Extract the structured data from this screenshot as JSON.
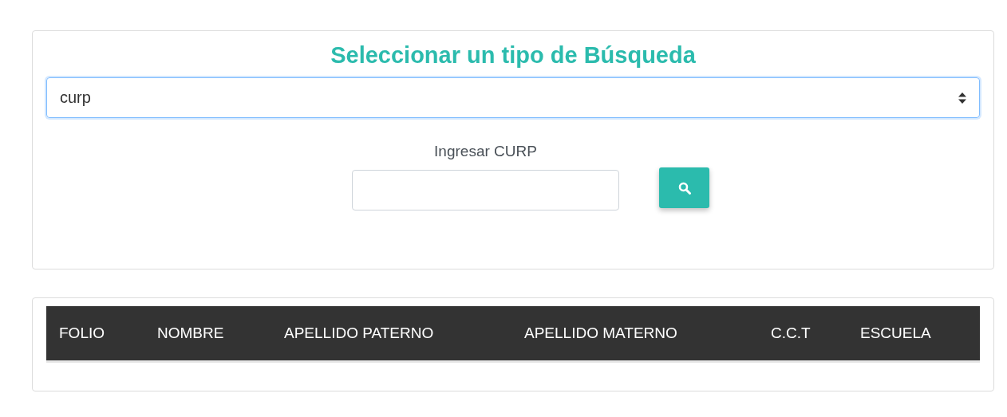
{
  "search_card": {
    "title": "Seleccionar un tipo de Búsqueda",
    "search_type": {
      "value": "curp"
    },
    "field_label": "Ingresar CURP"
  },
  "table": {
    "columns": [
      "FOLIO",
      "NOMBRE",
      "APELLIDO PATERNO",
      "APELLIDO MATERNO",
      "C.C.T",
      "ESCUELA"
    ]
  }
}
